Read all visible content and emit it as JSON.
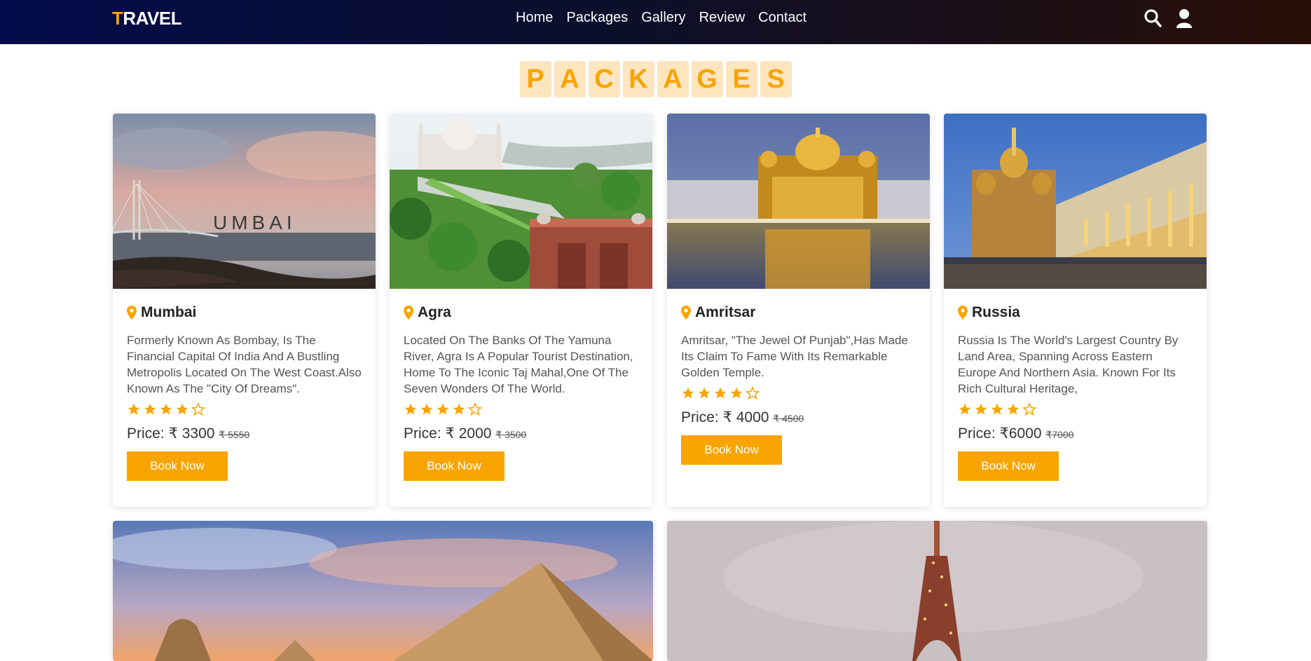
{
  "header": {
    "logo_first": "T",
    "logo_rest": "RAVEL",
    "nav": [
      "Home",
      "Packages",
      "Gallery",
      "Review",
      "Contact"
    ],
    "icons": [
      "search-icon",
      "user-icon"
    ]
  },
  "section": {
    "title_letters": [
      "P",
      "A",
      "C",
      "K",
      "A",
      "G",
      "E",
      "S"
    ]
  },
  "colors": {
    "accent": "#f9a400",
    "accent_light": "#fde5bf"
  },
  "packages": [
    {
      "name": "Mumbai",
      "image_text": "UMBAI",
      "description": "Formerly Known As Bombay, Is The Financial Capital Of India And A Bustling Metropolis Located On The West Coast.Also Known As The \"City Of Dreams\".",
      "rating": 4,
      "price": "Price: ₹ 3300",
      "old_price": "₹ 5550",
      "button": "Book Now"
    },
    {
      "name": "Agra",
      "description": "Located On The Banks Of The Yamuna River, Agra Is A Popular Tourist Destination, Home To The Iconic Taj Mahal,One Of The Seven Wonders Of The World.",
      "rating": 4,
      "price": "Price: ₹ 2000",
      "old_price": "₹ 3500",
      "button": "Book Now"
    },
    {
      "name": "Amritsar",
      "description": "Amritsar, \"The Jewel Of Punjab\",Has Made Its Claim To Fame With Its Remarkable Golden Temple.",
      "rating": 4,
      "price": "Price: ₹ 4000",
      "old_price": "₹ 4500",
      "button": "Book Now"
    },
    {
      "name": "Russia",
      "description": "Russia Is The World's Largest Country By Land Area, Spanning Across Eastern Europe And Northern Asia. Known For Its Rich Cultural Heritage,",
      "rating": 4,
      "price": "Price: ₹6000",
      "old_price": "₹7000",
      "button": "Book Now"
    }
  ]
}
